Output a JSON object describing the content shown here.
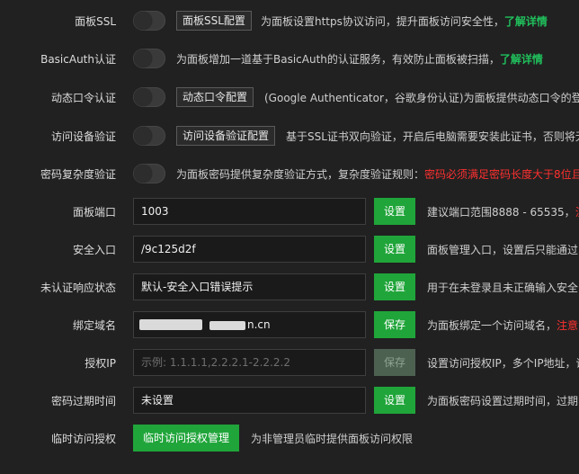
{
  "rows": [
    {
      "label": "面板SSL",
      "button": "面板SSL配置",
      "desc": "为面板设置https协议访问，提升面板访问安全性，",
      "link": "了解详情"
    },
    {
      "label": "BasicAuth认证",
      "desc": "为面板增加一道基于BasicAuth的认证服务，有效防止面板被扫描，",
      "link": "了解详情"
    },
    {
      "label": "动态口令认证",
      "button": "动态口令配置",
      "desc": "(Google Authenticator，谷歌身份认证)为面板提供动态口令的登"
    },
    {
      "label": "访问设备验证",
      "button": "访问设备验证配置",
      "desc": "基于SSL证书双向验证，开启后电脑需要安装此证书，否则将无"
    },
    {
      "label": "密码复杂度验证",
      "desc": "为面板密码提供复杂度验证方式，复杂度验证规则：",
      "warn": "密码必须满足密码长度大于8位且"
    },
    {
      "label": "面板端口",
      "value": "1003",
      "action": "设置",
      "desc": "建议端口范围8888 - 65535，",
      "warn": "注"
    },
    {
      "label": "安全入口",
      "value": "/9c125d2f",
      "action": "设置",
      "desc": "面板管理入口，设置后只能通过"
    },
    {
      "label": "未认证响应状态",
      "value": "默认-安全入口错误提示",
      "action": "设置",
      "desc": "用于在未登录且未正确输入安全"
    },
    {
      "label": "绑定域名",
      "value": "n.cn",
      "action": "保存",
      "desc": "为面板绑定一个访问域名，",
      "warn": "注意"
    },
    {
      "label": "授权IP",
      "placeholder": "示例: 1.1.1.1,2.2.2.1-2.2.2.2",
      "action": "保存",
      "desc": "设置访问授权IP，多个IP地址，请"
    },
    {
      "label": "密码过期时间",
      "value": "未设置",
      "action": "设置",
      "desc": "为面板密码设置过期时间，过期"
    },
    {
      "label": "临时访问授权",
      "action": "临时访问授权管理",
      "desc": "为非管理员临时提供面板访问权限"
    }
  ],
  "colors": {
    "accent": "#20a53a",
    "link": "#20c05c",
    "warning": "#ff3030",
    "background": "#212121"
  }
}
